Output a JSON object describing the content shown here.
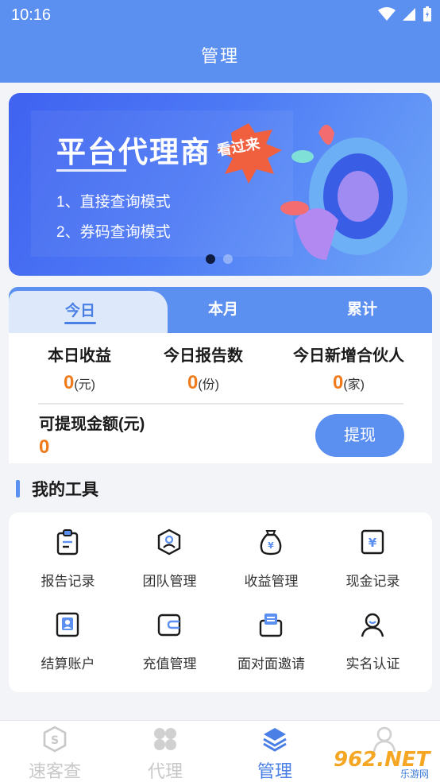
{
  "status_bar": {
    "time": "10:16"
  },
  "header": {
    "title": "管理"
  },
  "banner": {
    "title": "平台代理商",
    "badge": "看过来",
    "lines": [
      "1、直接查询模式",
      "2、券码查询模式"
    ]
  },
  "tabs": [
    {
      "label": "今日",
      "active": true
    },
    {
      "label": "本月",
      "active": false
    },
    {
      "label": "累计",
      "active": false
    }
  ],
  "stats": [
    {
      "label": "本日收益",
      "value": "0",
      "unit": "(元)"
    },
    {
      "label": "今日报告数",
      "value": "0",
      "unit": "(份)"
    },
    {
      "label": "今日新增合伙人",
      "value": "0",
      "unit": "(家)"
    }
  ],
  "withdraw": {
    "label": "可提现金额(元)",
    "value": "0",
    "button": "提现"
  },
  "tools": {
    "title": "我的工具",
    "items": [
      {
        "label": "报告记录",
        "icon": "clipboard-icon"
      },
      {
        "label": "团队管理",
        "icon": "team-hexagon-icon"
      },
      {
        "label": "收益管理",
        "icon": "money-bag-icon"
      },
      {
        "label": "现金记录",
        "icon": "cash-icon"
      },
      {
        "label": "结算账户",
        "icon": "account-card-icon"
      },
      {
        "label": "充值管理",
        "icon": "wallet-icon"
      },
      {
        "label": "面对面邀请",
        "icon": "invite-mail-icon"
      },
      {
        "label": "实名认证",
        "icon": "user-verify-icon"
      }
    ]
  },
  "tabbar": [
    {
      "label": "速客查",
      "icon": "hexagon-s-icon",
      "active": false
    },
    {
      "label": "代理",
      "icon": "grid-icon",
      "active": false
    },
    {
      "label": "管理",
      "icon": "layers-icon",
      "active": true
    },
    {
      "label": "",
      "icon": "user-icon",
      "active": false
    }
  ],
  "watermark": {
    "text": "962.NET",
    "sub": "乐游网"
  },
  "colors": {
    "primary": "#5b8ff0",
    "accent": "#f07b1d",
    "active_tab": "#4a7fe6"
  }
}
